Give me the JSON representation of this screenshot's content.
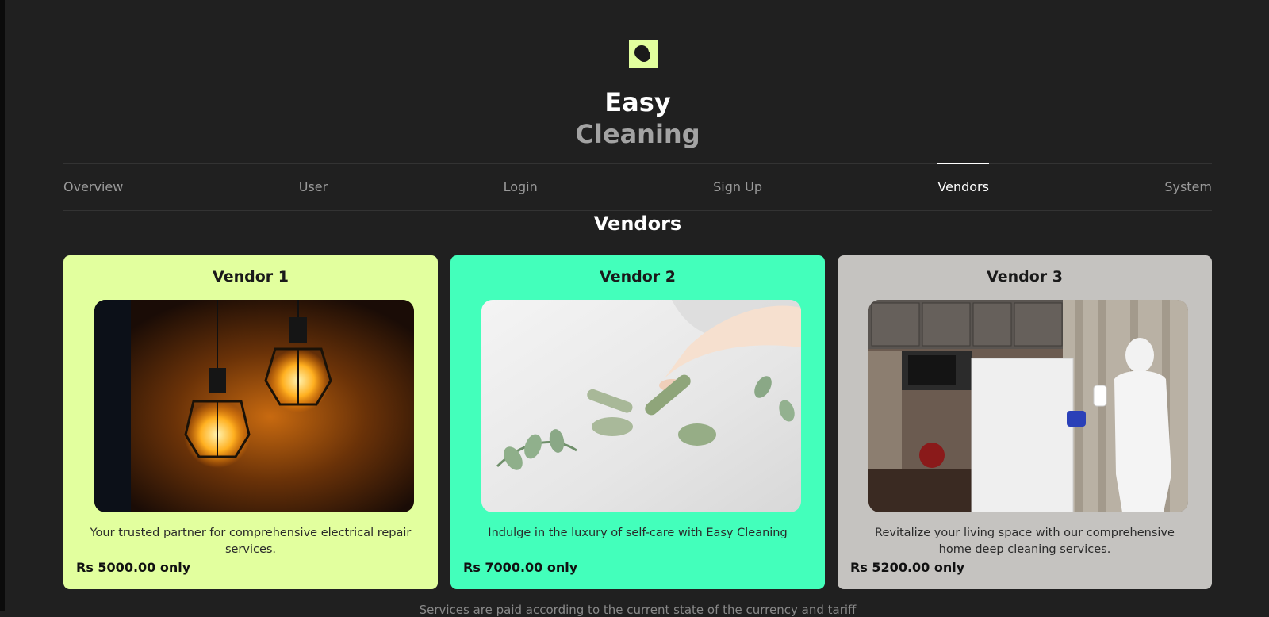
{
  "brand": {
    "logo_icon": "circles-logo-icon",
    "line1": "Easy",
    "line2": "Cleaning"
  },
  "nav": {
    "items": [
      {
        "label": "Overview",
        "active": false
      },
      {
        "label": "User",
        "active": false
      },
      {
        "label": "Login",
        "active": false
      },
      {
        "label": "Sign Up",
        "active": false
      },
      {
        "label": "Vendors",
        "active": true
      },
      {
        "label": "System",
        "active": false
      }
    ]
  },
  "section": {
    "title": "Vendors"
  },
  "vendors": [
    {
      "title": "Vendor 1",
      "image": "pendant-lamps-photo",
      "description": "Your trusted partner for comprehensive electrical repair services.",
      "price": "Rs 5000.00 only",
      "color": "#e2ff9e"
    },
    {
      "title": "Vendor 2",
      "image": "facial-roller-photo",
      "description": "Indulge in the luxury of self-care with Easy Cleaning",
      "price": "Rs 7000.00 only",
      "color": "#43ffbb"
    },
    {
      "title": "Vendor 3",
      "image": "kitchen-cleaning-photo",
      "description": "Revitalize your living space with our comprehensive home deep cleaning services.",
      "price": "Rs 5200.00 only",
      "color": "#c5c3c0"
    }
  ],
  "footer": {
    "note": "Services are paid according to the current state of the currency and tariff"
  },
  "colors": {
    "background": "#202020",
    "accent": "#e2ff9e",
    "nav_inactive": "#9a9a9a"
  }
}
